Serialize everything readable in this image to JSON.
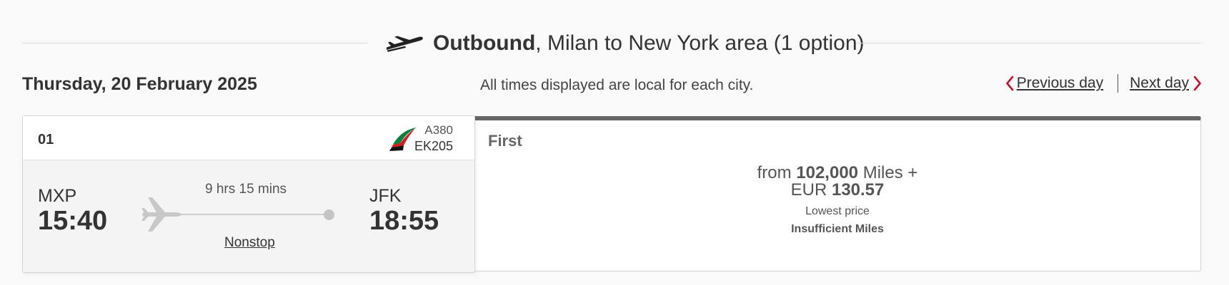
{
  "header": {
    "direction": "Outbound",
    "route": ", Milan to New York area (1 option)"
  },
  "date_row": {
    "date": "Thursday, 20 February 2025",
    "timezone_note": "All times displayed are local for each city.",
    "previous_day": "Previous day",
    "next_day": "Next day"
  },
  "flight": {
    "option_number": "01",
    "aircraft": "A380",
    "flight_number": "EK205",
    "origin_code": "MXP",
    "departure_time": "15:40",
    "destination_code": "JFK",
    "arrival_time": "18:55",
    "duration": "9 hrs 15 mins",
    "stops": "Nonstop"
  },
  "fare": {
    "cabin": "First",
    "price_prefix": "from ",
    "miles": "102,000",
    "miles_suffix": " Miles +",
    "currency": "EUR ",
    "cash": "130.57",
    "note": "Lowest price",
    "status": "Insufficient Miles"
  },
  "colors": {
    "accent_red": "#c8102e",
    "logo_green": "#00843d",
    "logo_red": "#d71921"
  },
  "icons": {
    "header": "plane-takeoff-icon",
    "route": "plane-icon",
    "airline": "emirates-logo",
    "prev": "chevron-left-icon",
    "next": "chevron-right-icon"
  }
}
